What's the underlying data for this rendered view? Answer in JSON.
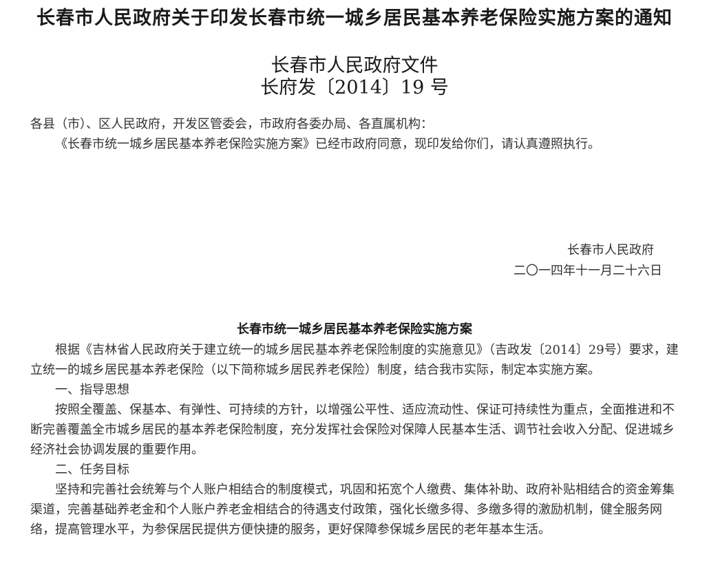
{
  "notice": {
    "title": "长春市人民政府关于印发长春市统一城乡居民基本养老保险实施方案的通知",
    "issuer": "长春市人民政府文件",
    "doc_number": "长府发〔2014〕19 号",
    "addressee": "各县（市）、区人民政府，开发区管委会，市政府各委办局、各直属机构：",
    "body": "《长春市统一城乡居民基本养老保险实施方案》已经市政府同意，现印发给你们，请认真遵照执行。",
    "signature_org": "长春市人民政府",
    "signature_date": "二〇一四年十一月二十六日"
  },
  "plan": {
    "title": "长春市统一城乡居民基本养老保险实施方案",
    "intro": "根据《吉林省人民政府关于建立统一的城乡居民基本养老保险制度的实施意见》（吉政发〔2014〕29号）要求，建立统一的城乡居民基本养老保险（以下简称城乡居民养老保险）制度，结合我市实际，制定本实施方案。",
    "section1_heading": "一、指导思想",
    "section1_body": "按照全覆盖、保基本、有弹性、可持续的方针，以增强公平性、适应流动性、保证可持续性为重点，全面推进和不断完善覆盖全市城乡居民的基本养老保险制度，充分发挥社会保险对保障人民基本生活、调节社会收入分配、促进城乡经济社会协调发展的重要作用。",
    "section2_heading": "二、任务目标",
    "section2_body": "坚持和完善社会统筹与个人账户相结合的制度模式，巩固和拓宽个人缴费、集体补助、政府补贴相结合的资金筹集渠道，完善基础养老金和个人账户养老金相结合的待遇支付政策，强化长缴多得、多缴多得的激励机制，健全服务网络，提高管理水平，为参保居民提供方便快捷的服务，更好保障参保城乡居民的老年基本生活。"
  }
}
